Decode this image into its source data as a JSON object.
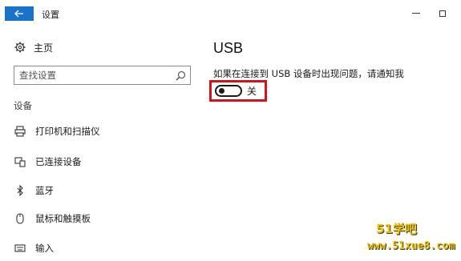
{
  "window": {
    "title": "设置"
  },
  "sidebar": {
    "home_label": "主页",
    "search_placeholder": "查找设置",
    "section_label": "设备",
    "items": [
      {
        "label": "打印机和扫描仪",
        "icon": "printer-icon"
      },
      {
        "label": "已连接设备",
        "icon": "connected-devices-icon"
      },
      {
        "label": "蓝牙",
        "icon": "bluetooth-icon"
      },
      {
        "label": "鼠标和触摸板",
        "icon": "mouse-icon"
      },
      {
        "label": "输入",
        "icon": "keyboard-icon"
      }
    ]
  },
  "main": {
    "title": "USB",
    "notify_text": "如果在连接到 USB 设备时出现问题，请通知我",
    "toggle_state": "关",
    "toggle_on": false
  },
  "watermark": {
    "line1": "51学吧",
    "line2": "www.51xue8.com"
  },
  "colors": {
    "accent": "#1a73c8",
    "highlight": "#d2131a",
    "watermark": "#f0c400"
  }
}
